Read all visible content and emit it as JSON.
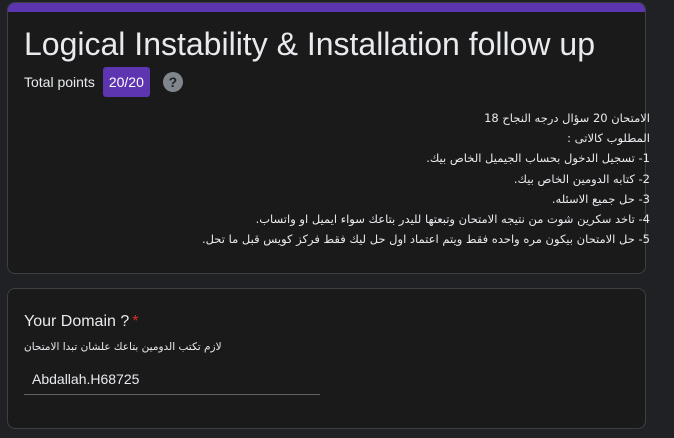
{
  "theme": {
    "accent": "#5e35b1",
    "background": "#202124",
    "card": "#1a1a1b",
    "required": "#d93025"
  },
  "header": {
    "title": "Logical Instability & Installation follow up",
    "total_points_label": "Total points",
    "score": "20/20",
    "help_icon": "help-circle-icon"
  },
  "description": {
    "lines": [
      "الامتحان 20 سؤال درجه النجاح 18",
      "المطلوب كالاتى :",
      "1- تسجيل الدخول بحساب الجيميل الخاص بيك.",
      "2- كتابه الدومين الخاص بيك.",
      "3- حل جميع الاسئله.",
      "4- تاخد سكرين شوت من نتيجه الامتحان وتبعتها لليدر بتاعك سواء ايميل او واتساب.",
      "5- حل الامتحان بيكون مره واحده فقط ويتم اعتماد اول حل ليك فقط فركز كويس قبل ما تحل."
    ]
  },
  "question": {
    "title": "Your Domain ?",
    "required_mark": "*",
    "help_text": "لازم تكتب الدومين بتاعك علشان تبدا الامتحان",
    "answer": "Abdallah.H68725"
  }
}
